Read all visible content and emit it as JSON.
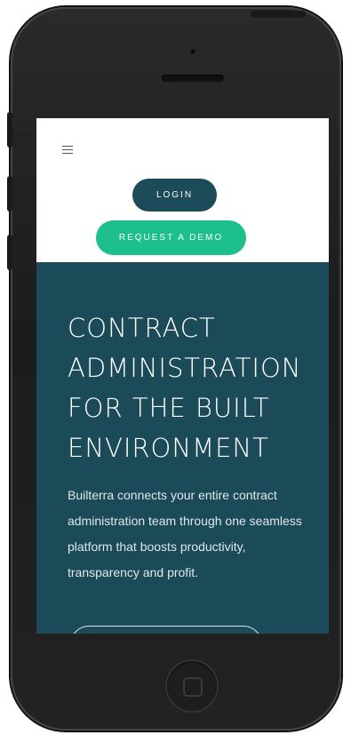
{
  "header": {
    "login_label": "LOGIN",
    "demo_label": "REQUEST A DEMO"
  },
  "hero": {
    "title": "CONTRACT\nADMINISTRATION\nFOR THE BUILT\nENVIRONMENT",
    "subtitle": "Builterra connects your entire contract administration team through one seamless platform that boosts productivity, transparency and profit."
  },
  "colors": {
    "primary": "#1b4a59",
    "login_button": "#1c4c5a",
    "accent": "#1dc08c"
  },
  "icons": {
    "menu": "hamburger-icon"
  }
}
